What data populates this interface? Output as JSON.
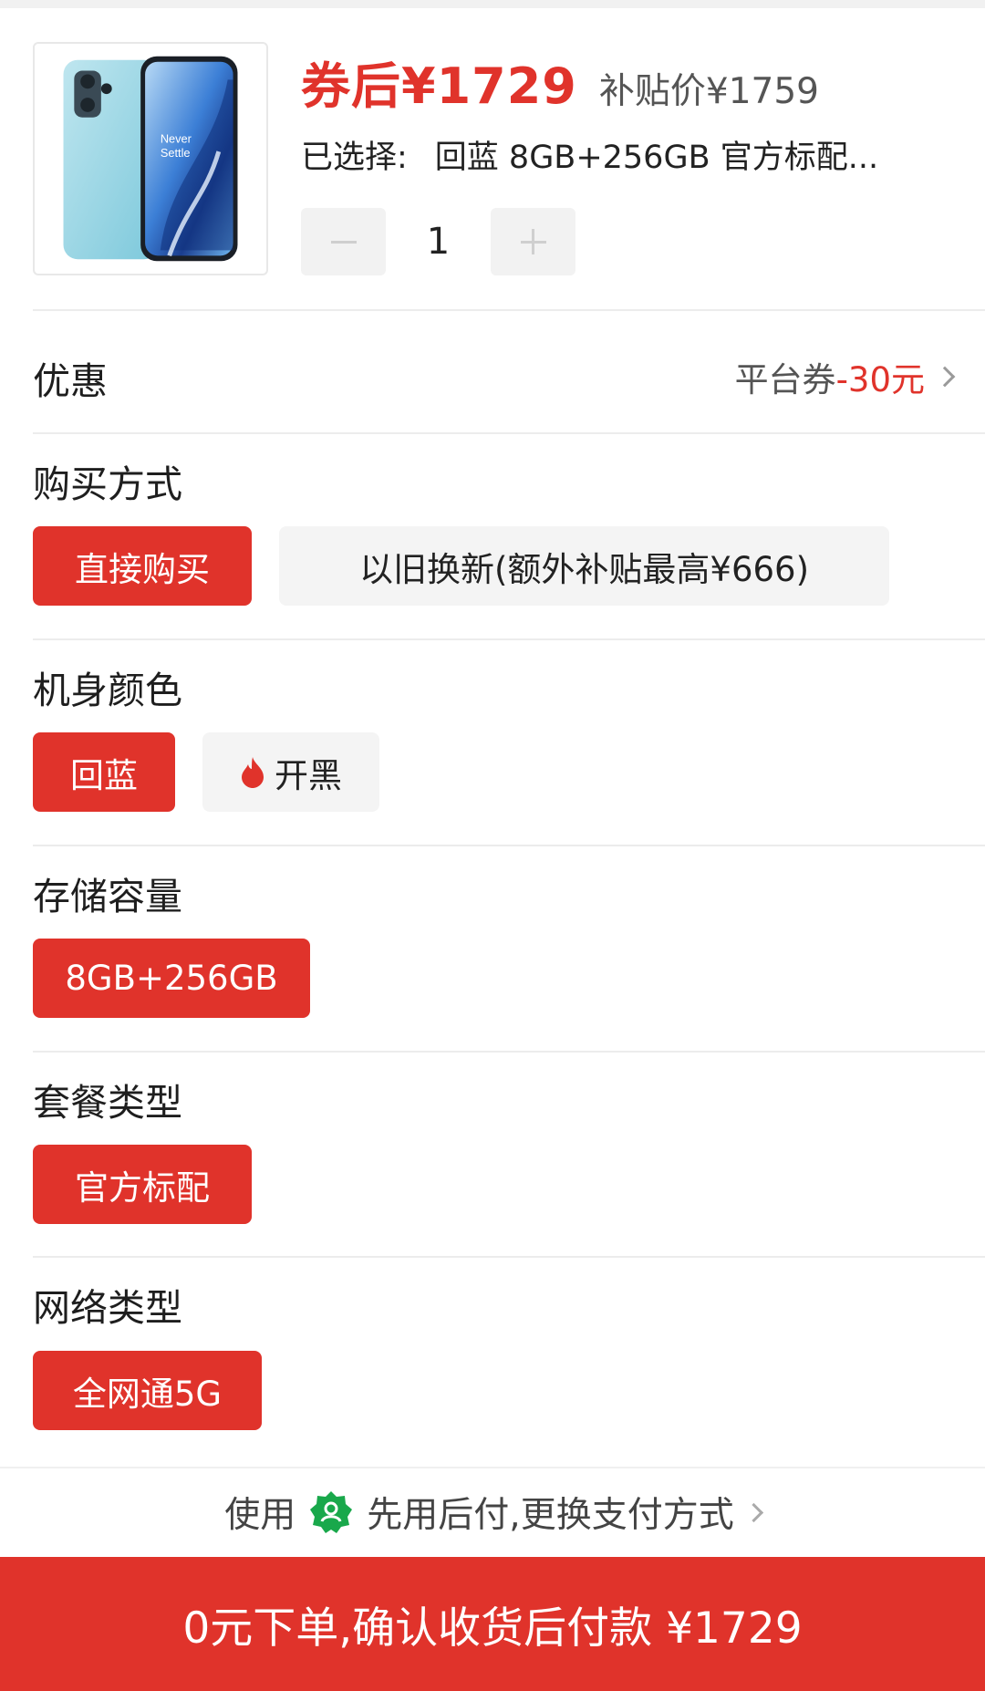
{
  "product": {
    "image_alt": "phone-product-image",
    "image_text": "Never Settle",
    "price_after_coupon": "券后¥1729",
    "subsidy_price": "补贴价¥1759",
    "selected_label": "已选择:",
    "selected_value": "回蓝 8GB+256GB 官方标配...",
    "quantity": "1"
  },
  "discount": {
    "title": "优惠",
    "coupon_label": "平台券",
    "coupon_value": "-30元"
  },
  "sections": {
    "purchase": {
      "title": "购买方式",
      "options": [
        "直接购买",
        "以旧换新(额外补贴最高¥666)"
      ]
    },
    "color": {
      "title": "机身颜色",
      "options": [
        "回蓝",
        "开黑"
      ]
    },
    "storage": {
      "title": "存储容量",
      "options": [
        "8GB+256GB"
      ]
    },
    "package": {
      "title": "套餐类型",
      "options": [
        "官方标配"
      ]
    },
    "network": {
      "title": "网络类型",
      "options": [
        "全网通5G"
      ]
    }
  },
  "payment": {
    "prefix": "使用",
    "text": "先用后付,更换支付方式"
  },
  "cta": {
    "label": "0元下单,确认收货后付款 ¥1729"
  },
  "colors": {
    "accent": "#e0332b",
    "badge_green": "#19a84b",
    "option_bg": "#f4f4f4"
  }
}
